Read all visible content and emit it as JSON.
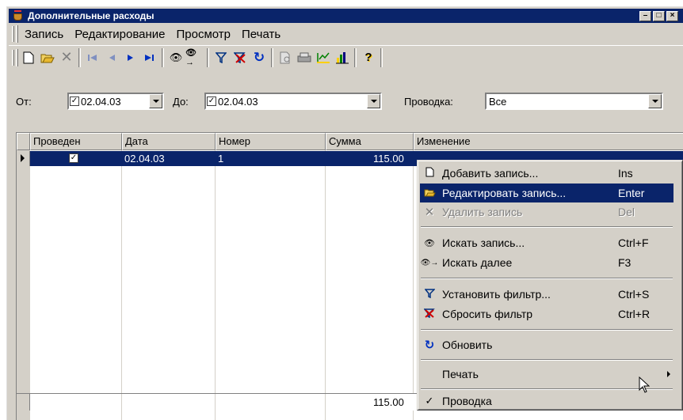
{
  "window": {
    "title": "Дополнительные расходы"
  },
  "menubar": [
    "Запись",
    "Редактирование",
    "Просмотр",
    "Печать"
  ],
  "filter": {
    "from_label": "От:",
    "from_value": "02.04.03",
    "to_label": "До:",
    "to_value": "02.04.03",
    "posting_label": "Проводка:",
    "posting_value": "Все"
  },
  "grid": {
    "columns": [
      "Проведен",
      "Дата",
      "Номер",
      "Сумма",
      "Изменение"
    ],
    "row": {
      "date": "02.04.03",
      "number": "1",
      "sum": "115.00"
    },
    "total": "115.00"
  },
  "context_menu": {
    "add": {
      "label": "Добавить запись...",
      "shortcut": "Ins"
    },
    "edit": {
      "label": "Редактировать запись...",
      "shortcut": "Enter"
    },
    "delete": {
      "label": "Удалить запись",
      "shortcut": "Del"
    },
    "find": {
      "label": "Искать запись...",
      "shortcut": "Ctrl+F"
    },
    "find_next": {
      "label": "Искать далее",
      "shortcut": "F3"
    },
    "set_filter": {
      "label": "Установить фильтр...",
      "shortcut": "Ctrl+S"
    },
    "reset_filter": {
      "label": "Сбросить фильтр",
      "shortcut": "Ctrl+R"
    },
    "refresh": {
      "label": "Обновить"
    },
    "print": {
      "label": "Печать"
    },
    "posting": {
      "label": "Проводка"
    }
  },
  "colors": {
    "selection": "#0a246a",
    "face": "#d4d0c8"
  }
}
